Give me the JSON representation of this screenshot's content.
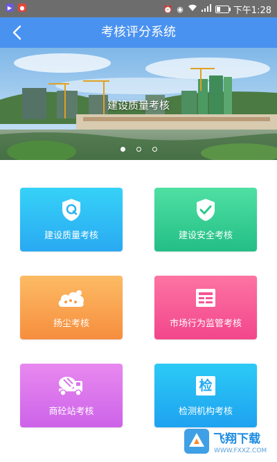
{
  "status_bar": {
    "time": "下午1:28",
    "battery_level": 0.3,
    "icons": [
      "alarm-icon",
      "eye-icon",
      "wifi-icon",
      "signal-icon",
      "battery-icon"
    ]
  },
  "nav": {
    "title": "考核评分系统",
    "back_icon": "chevron-left-icon"
  },
  "banner": {
    "caption": "建设质量考核",
    "slide_count": 3,
    "active_slide": 1
  },
  "menu": {
    "items": [
      {
        "label": "建设质量考核",
        "icon": "shield-q-icon",
        "color": "#36d2f7"
      },
      {
        "label": "建设安全考核",
        "icon": "shield-check-icon",
        "color": "#4fe0a3"
      },
      {
        "label": "扬尘考核",
        "icon": "dust-cloud-icon",
        "color": "#fdbb64"
      },
      {
        "label": "市场行为监管考核",
        "icon": "market-card-icon",
        "color": "#fd74a2"
      },
      {
        "label": "商砼站考核",
        "icon": "concrete-truck-icon",
        "color": "#e889ef"
      },
      {
        "label": "检测机构考核",
        "icon": "inspection-icon",
        "color": "#2ccaf6"
      }
    ],
    "inspection_glyph": "检"
  },
  "watermark": {
    "text": "飞翔下载",
    "url_text": "WWW.FXXZ.COM"
  }
}
